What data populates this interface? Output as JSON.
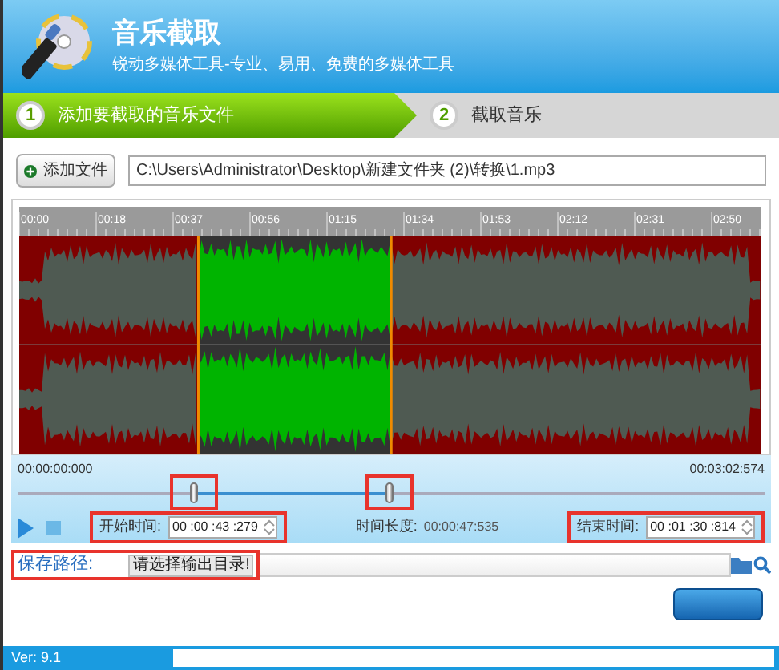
{
  "header": {
    "title": "音乐截取",
    "subtitle": "锐动多媒体工具-专业、易用、免费的多媒体工具"
  },
  "steps": [
    {
      "number": "1",
      "label": "添加要截取的音乐文件",
      "selected": true
    },
    {
      "number": "2",
      "label": "截取音乐",
      "selected": false
    }
  ],
  "file": {
    "button": "添加文件",
    "path": "C:\\Users\\Administrator\\Desktop\\新建文件夹 (2)\\转换\\1.mp3"
  },
  "waveform": {
    "ruler": [
      "00:00",
      "00:18",
      "00:37",
      "00:56",
      "01:15",
      "01:34",
      "01:53",
      "02:12",
      "02:31",
      "02:50"
    ]
  },
  "range": {
    "min": "00:00:00:000",
    "max": "00:03:02:574",
    "handles": [
      {
        "level": 0.237
      },
      {
        "level": 0.497
      }
    ]
  },
  "playback": {
    "start_label": "开始时间:",
    "start_value": "00 :00 :43 :279",
    "duration_label": "时间长度:",
    "duration_value": "00:00:47:535",
    "end_label": "结束时间:",
    "end_value": "00 :01 :30 :814"
  },
  "output": {
    "label": "保存路径:",
    "placeholder": "请选择输出目录!"
  },
  "status_bar": {
    "version": "Ver: 9.1"
  }
}
